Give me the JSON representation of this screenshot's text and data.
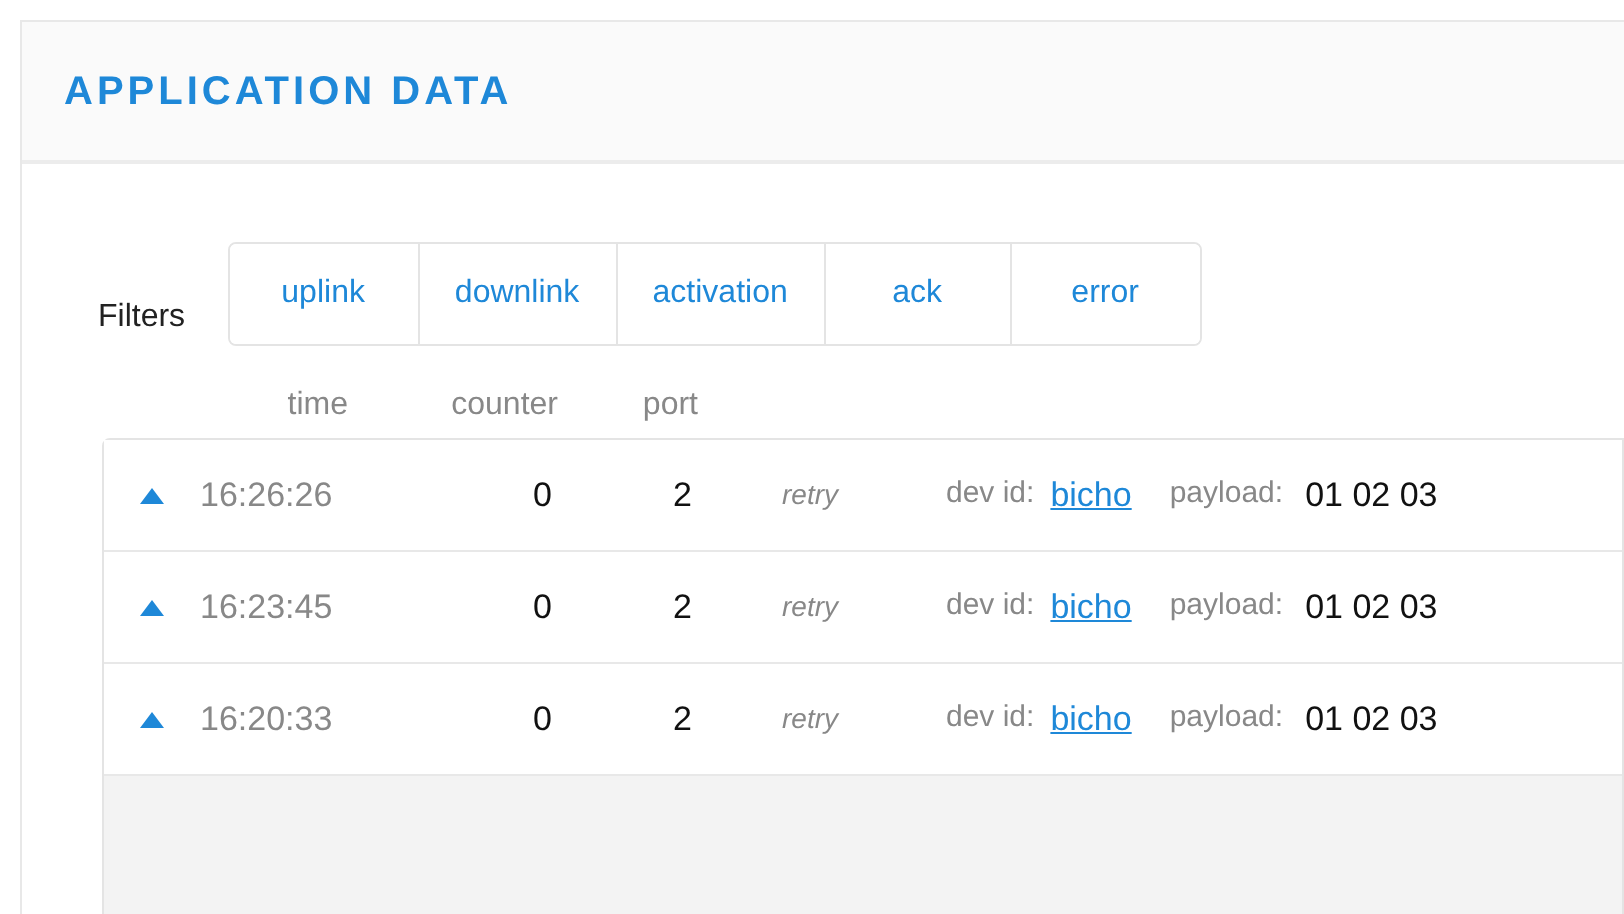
{
  "header": {
    "title": "APPLICATION DATA"
  },
  "filters": {
    "label": "Filters",
    "items": [
      {
        "label": "uplink",
        "selected": false
      },
      {
        "label": "downlink",
        "selected": false
      },
      {
        "label": "activation",
        "selected": false
      },
      {
        "label": "ack",
        "selected": false
      },
      {
        "label": "error",
        "selected": false
      }
    ]
  },
  "table": {
    "columns": [
      "time",
      "counter",
      "port"
    ],
    "rows": [
      {
        "kind": "uplink",
        "time": "16:26:26",
        "counter": "0",
        "port": "2",
        "tag": "retry",
        "dev_id_label": "dev id:",
        "dev_id": "bicho",
        "payload_label": "payload:",
        "payload": "01 02 03"
      },
      {
        "kind": "uplink",
        "time": "16:23:45",
        "counter": "0",
        "port": "2",
        "tag": "retry",
        "dev_id_label": "dev id:",
        "dev_id": "bicho",
        "payload_label": "payload:",
        "payload": "01 02 03"
      },
      {
        "kind": "uplink",
        "time": "16:20:33",
        "counter": "0",
        "port": "2",
        "tag": "retry",
        "dev_id_label": "dev id:",
        "dev_id": "bicho",
        "payload_label": "payload:",
        "payload": "01 02 03"
      }
    ]
  }
}
